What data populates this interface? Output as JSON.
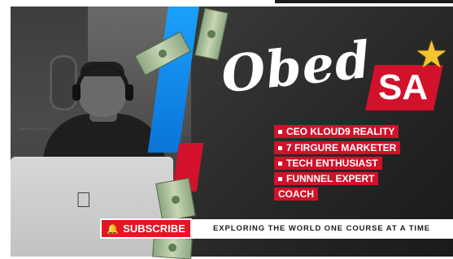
{
  "brand": {
    "first_name": "Obed",
    "last_name": "SA"
  },
  "roles": [
    "CEO KLOUD9 REALITY",
    "7 FIRGURE MARKETER",
    "TECH ENTHUSIAST",
    "FUNNNEL EXPERT",
    "COACH"
  ],
  "subscribe": {
    "label": "SUBSCRIBE",
    "icon": "bell-icon"
  },
  "tagline": "EXPLORING THE WORLD ONE COURSE AT A TIME",
  "colors": {
    "accent_red": "#d2112a",
    "accent_blue": "#1aa3ff",
    "star": "#f4c430",
    "dark_bg": "#2c2c2c"
  },
  "icons": [
    "apple-logo-icon",
    "star-icon",
    "bell-icon",
    "banknote-icon"
  ]
}
